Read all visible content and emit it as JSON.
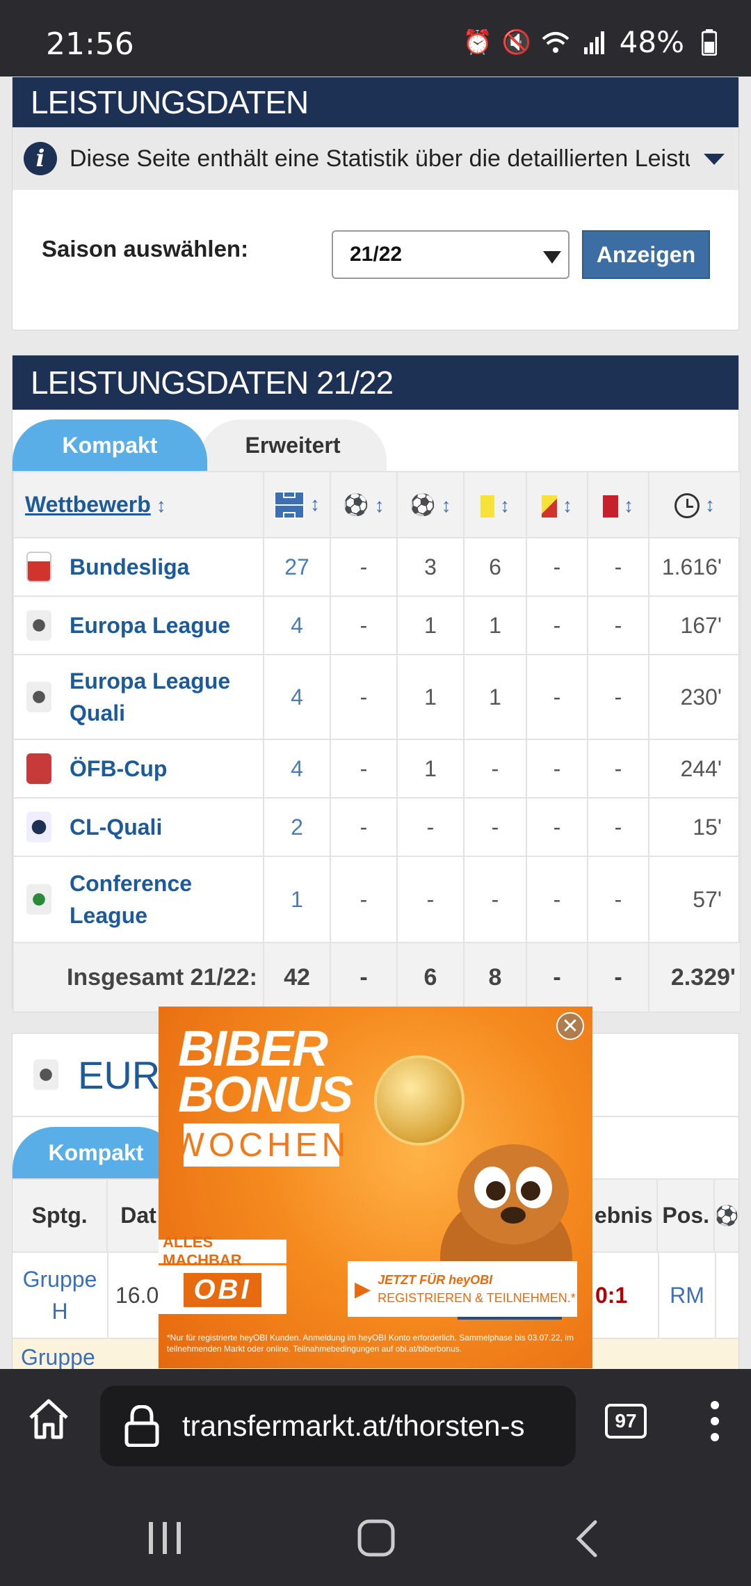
{
  "status_bar": {
    "time": "21:56",
    "battery": "48%"
  },
  "section1": {
    "title": "LEISTUNGSDATEN",
    "info_text": "Diese Seite enthält eine Statistik über die detaillierten Leistungsd...",
    "season_label": "Saison auswählen:",
    "season_value": "21/22",
    "show_button": "Anzeigen"
  },
  "section2": {
    "title": "LEISTUNGSDATEN 21/22",
    "tabs": [
      "Kompakt",
      "Erweitert"
    ],
    "header_competition": "Wettbewerb",
    "rows": [
      {
        "competition": "Bundesliga",
        "apps": "27",
        "c1": "-",
        "goals": "3",
        "yellow": "6",
        "yr": "-",
        "red": "-",
        "minutes": "1.616'"
      },
      {
        "competition": "Europa League",
        "apps": "4",
        "c1": "-",
        "goals": "1",
        "yellow": "1",
        "yr": "-",
        "red": "-",
        "minutes": "167'"
      },
      {
        "competition": "Europa League Quali",
        "apps": "4",
        "c1": "-",
        "goals": "1",
        "yellow": "1",
        "yr": "-",
        "red": "-",
        "minutes": "230'"
      },
      {
        "competition": "ÖFB-Cup",
        "apps": "4",
        "c1": "-",
        "goals": "1",
        "yellow": "-",
        "yr": "-",
        "red": "-",
        "minutes": "244'"
      },
      {
        "competition": "CL-Quali",
        "apps": "2",
        "c1": "-",
        "goals": "-",
        "yellow": "-",
        "yr": "-",
        "red": "-",
        "minutes": "15'"
      },
      {
        "competition": "Conference League",
        "apps": "1",
        "c1": "-",
        "goals": "-",
        "yellow": "-",
        "yr": "-",
        "red": "-",
        "minutes": "57'"
      }
    ],
    "total": {
      "label": "Insgesamt 21/22:",
      "apps": "42",
      "c1": "-",
      "goals": "6",
      "yellow": "8",
      "yr": "-",
      "red": "-",
      "minutes": "2.329'"
    }
  },
  "section3": {
    "title": "EURO",
    "tab": "Kompakt",
    "headers": [
      "Sptg.",
      "Dat",
      "ebnis",
      "Pos."
    ],
    "row1": {
      "matchday": "Gruppe H",
      "date": "16.0",
      "result": "0:1",
      "pos": "RM"
    },
    "row2_partial": "Gruppe"
  },
  "ad": {
    "line1": "BIBER",
    "line2": "BONUS",
    "line3": "WOCHEN",
    "tag": "ALLES MACHBAR",
    "brand": "OBI",
    "cta1": "JETZT FÜR heyOBI",
    "cta2": "REGISTRIEREN & TEILNEHMEN.*",
    "fineprint": "*Nur für registrierte heyOBI Kunden. Anmeldung im heyOBI Konto erforderlich. Sammelphase bis 03.07.22, im teilnehmenden Markt oder online. Teilnahmebedingungen auf obi.at/biberbonus."
  },
  "browser": {
    "url": "transfermarkt.at/thorsten-s",
    "tabs_count": "97"
  },
  "colors": {
    "header_navy": "#1d3154",
    "tab_blue": "#5aaee8",
    "link_blue": "#1d5a99",
    "ad_orange": "#f07a1a"
  }
}
